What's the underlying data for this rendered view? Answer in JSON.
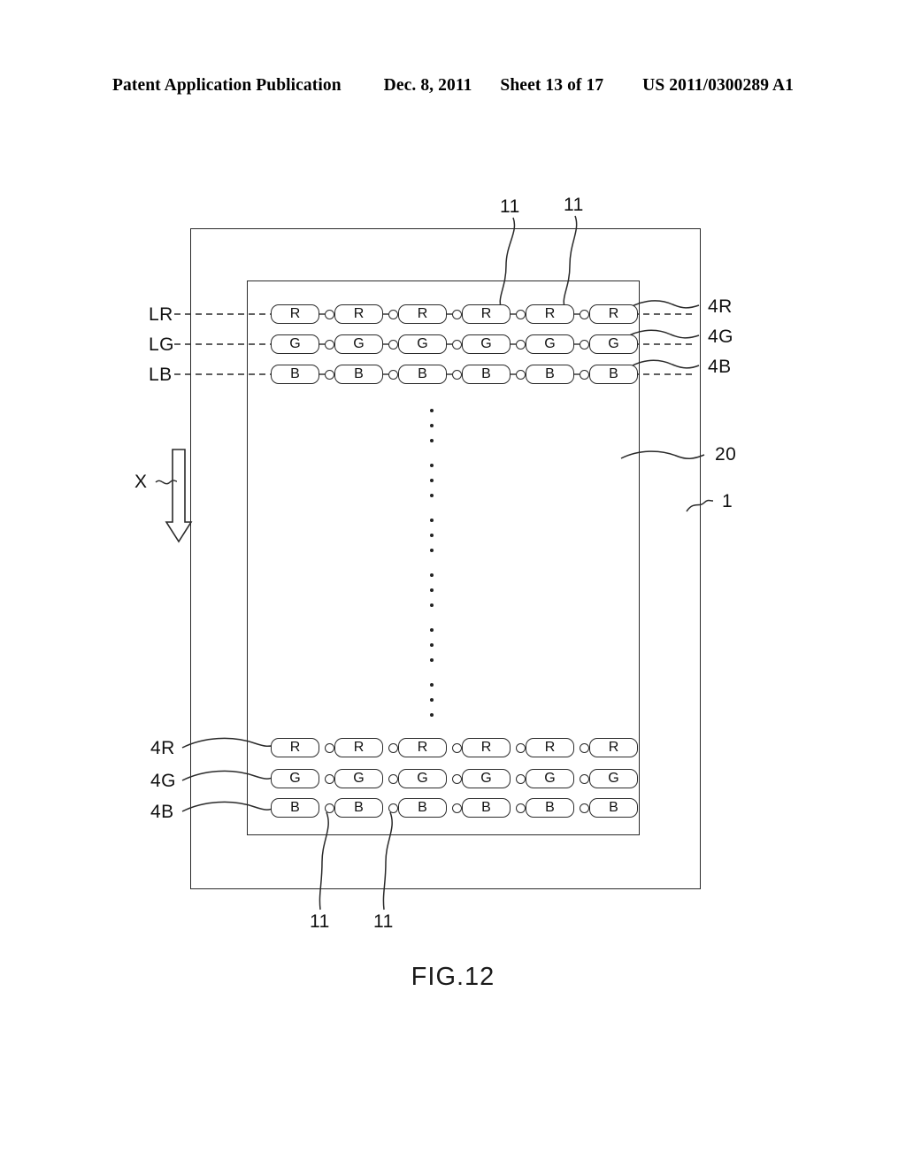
{
  "header": {
    "publication": "Patent Application Publication",
    "date": "Dec. 8, 2011",
    "sheet": "Sheet 13 of 17",
    "docnum": "US 2011/0300289 A1"
  },
  "figure": {
    "caption": "FIG.12",
    "axis_label": "X",
    "outer_ref": "1",
    "inner_ref": "20",
    "left_line_labels": [
      "LR",
      "LG",
      "LB"
    ],
    "right_row_refs": [
      "4R",
      "4G",
      "4B"
    ],
    "bottom_left_row_refs": [
      "4R",
      "4G",
      "4B"
    ],
    "node_ref_top": [
      "11",
      "11"
    ],
    "node_ref_bottom": [
      "11",
      "11"
    ],
    "top_rows": [
      {
        "label": "LR",
        "ref": "4R",
        "cells": [
          "R",
          "R",
          "R",
          "R",
          "R",
          "R"
        ]
      },
      {
        "label": "LG",
        "ref": "4G",
        "cells": [
          "G",
          "G",
          "G",
          "G",
          "G",
          "G"
        ]
      },
      {
        "label": "LB",
        "ref": "4B",
        "cells": [
          "B",
          "B",
          "B",
          "B",
          "B",
          "B"
        ]
      }
    ],
    "bottom_rows": [
      {
        "ref": "4R",
        "cells": [
          "R",
          "R",
          "R",
          "R",
          "R",
          "R"
        ]
      },
      {
        "ref": "4G",
        "cells": [
          "G",
          "G",
          "G",
          "G",
          "G",
          "G"
        ]
      },
      {
        "ref": "4B",
        "cells": [
          "B",
          "B",
          "B",
          "B",
          "B",
          "B"
        ]
      }
    ],
    "vertical_ellipsis_groups": 6,
    "colors": {
      "ink": "#2a2a2a",
      "paper": "#ffffff"
    }
  }
}
